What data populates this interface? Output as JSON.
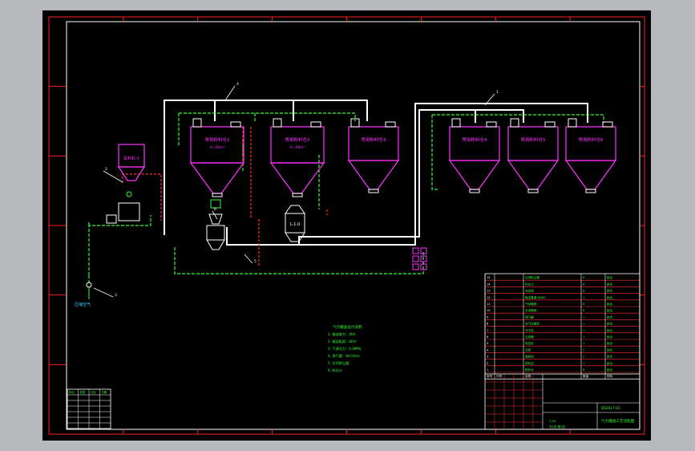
{
  "colors": {
    "background_outer": "#b7b9bd",
    "canvas": "#000000",
    "frame": "#ff2020",
    "inner_frame": "#ffffff",
    "silo": "#ff33ff",
    "pipe_main": "#ffffff",
    "pipe_air": "#33ff33",
    "pipe_red": "#ff3030",
    "text": "#33ff33",
    "blue": "#33ccff",
    "yellow": "#ffff33"
  },
  "silos": [
    {
      "id": "silo-1",
      "label": "常用粉料仓1",
      "sub": "V=50m³"
    },
    {
      "id": "silo-2",
      "label": "常用粉料仓2",
      "sub": "V=50m³"
    },
    {
      "id": "silo-3",
      "label": "常用粉料仓3",
      "sub": ""
    },
    {
      "id": "silo-4",
      "label": "常用粉料仓4",
      "sub": ""
    },
    {
      "id": "silo-5",
      "label": "常用粉料仓5",
      "sub": ""
    },
    {
      "id": "silo-6",
      "label": "常用粉料仓6",
      "sub": ""
    }
  ],
  "feed_hopper": {
    "label": "投料料斗"
  },
  "pump_label": "L-1.0",
  "callouts": [
    "4",
    "1",
    "2",
    "3",
    "5",
    "6"
  ],
  "notes": {
    "title": "气力输送设计说明",
    "lines": [
      "1. 输送能力：4t/h",
      "2. 输送距离：80m",
      "3. 气源压力：0.6MPa",
      "4. 用气量：8m³/min",
      "5. 仓顶除尘器",
      "6. 料位计"
    ]
  },
  "parts_table": {
    "rows": [
      {
        "no": "15",
        "code": "",
        "name": "仓顶除尘器",
        "qty": "6",
        "mat": "组合"
      },
      {
        "no": "14",
        "code": "",
        "name": "料位计",
        "qty": "6",
        "mat": "组合"
      },
      {
        "no": "13",
        "code": "",
        "name": "安全阀",
        "qty": "6",
        "mat": "组合"
      },
      {
        "no": "12",
        "code": "",
        "name": "输送管道 DN80",
        "qty": "1",
        "mat": "组合"
      },
      {
        "no": "11",
        "code": "",
        "name": "气动蝶阀",
        "qty": "8",
        "mat": "组合"
      },
      {
        "no": "10",
        "code": "",
        "name": "手动蝶阀",
        "qty": "6",
        "mat": "组合"
      },
      {
        "no": "9",
        "code": "",
        "name": "储气罐",
        "qty": "1",
        "mat": "组合"
      },
      {
        "no": "8",
        "code": "",
        "name": "空气压缩机",
        "qty": "1",
        "mat": "组合"
      },
      {
        "no": "7",
        "code": "",
        "name": "冷干机",
        "qty": "1",
        "mat": "组合"
      },
      {
        "no": "6",
        "code": "",
        "name": "过滤器",
        "qty": "1",
        "mat": "组合"
      },
      {
        "no": "5",
        "code": "",
        "name": "电控柜",
        "qty": "1",
        "mat": "组合"
      },
      {
        "no": "4",
        "code": "",
        "name": "仓泵",
        "qty": "2",
        "mat": "组合"
      },
      {
        "no": "3",
        "code": "",
        "name": "旋转阀",
        "qty": "2",
        "mat": "组合"
      },
      {
        "no": "2",
        "code": "",
        "name": "投料站",
        "qty": "1",
        "mat": "组合"
      },
      {
        "no": "1",
        "code": "",
        "name": "粉料仓",
        "qty": "6",
        "mat": "组合"
      }
    ],
    "header": {
      "no": "序号",
      "code": "代号",
      "name": "名称",
      "qty": "数量",
      "mat": "材料"
    }
  },
  "title_block": {
    "drawing_no": "QS2017-01",
    "title": "气力输送工艺流程图",
    "company": "",
    "scale": "1:50",
    "sheet": "共1张 第1张"
  },
  "rev_table": {
    "header": [
      "标记",
      "处数",
      "分区",
      "日期"
    ],
    "rows": [
      [
        "",
        "",
        "",
        ""
      ],
      [
        "",
        "",
        "",
        ""
      ],
      [
        "",
        "",
        "",
        ""
      ],
      [
        "",
        "",
        "",
        ""
      ],
      [
        "",
        "",
        "",
        ""
      ],
      [
        "",
        "",
        "",
        ""
      ]
    ]
  }
}
